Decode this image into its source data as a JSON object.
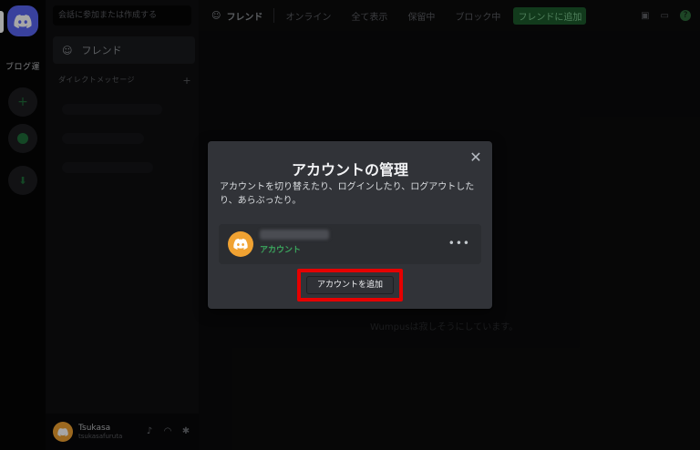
{
  "sidebar": {
    "search_placeholder": "会話に参加または作成する",
    "friends_label": "フレンド",
    "dm_header": "ダイレクトメッセージ",
    "dm_add": "+",
    "user": {
      "name": "Tsukasa",
      "tag": "tsukasafuruta"
    }
  },
  "rail": {
    "label": "ブログ運"
  },
  "topbar": {
    "title": "フレンド",
    "tabs": [
      "オンライン",
      "全て表示",
      "保留中",
      "ブロック中"
    ],
    "add_friend": "フレンドに追加"
  },
  "main": {
    "empty_text": "Wumpusは寂しそうにしています。"
  },
  "modal": {
    "title": "アカウントの管理",
    "description": "アカウントを切り替えたり、ログインしたり、ログアウトしたり、あらぶったり。",
    "account_status": "アカウント",
    "more_label": "•••",
    "add_account_button": "アカウントを追加",
    "close_icon": "close-icon"
  },
  "colors": {
    "brand": "#5865f2",
    "avatar": "#f0a232",
    "status": "#3ba55d",
    "highlight": "#e50000"
  }
}
